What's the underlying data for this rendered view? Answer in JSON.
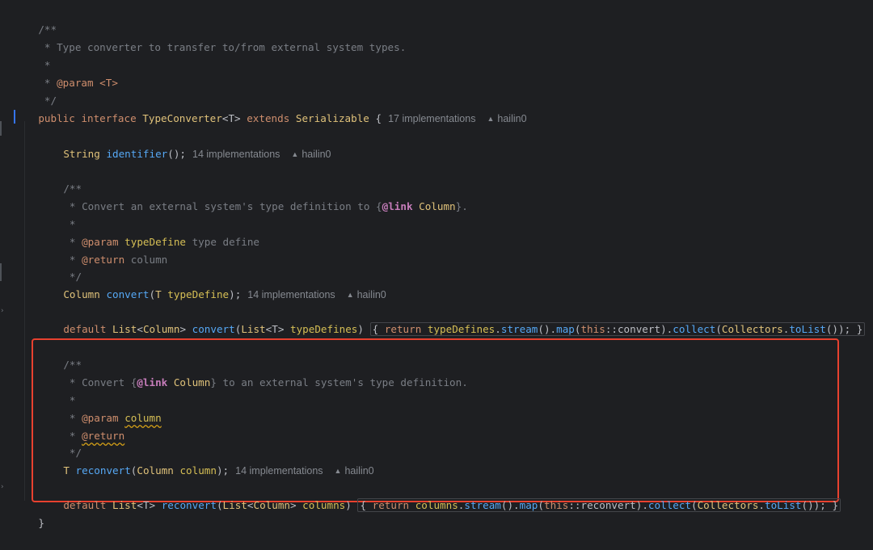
{
  "code": {
    "l1": "/**",
    "l2_star": " *",
    "l2_text": " Type converter to transfer to/from external system types.",
    "l3": " *",
    "l4_star": " * ",
    "l4_tag": "@param",
    "l4_val": " <T>",
    "l5": " */",
    "iface_public": "public",
    "iface_interface": "interface",
    "iface_name": "TypeConverter",
    "iface_generic": "<T>",
    "iface_extends": "extends",
    "iface_serializable": "Serializable",
    "iface_brace": "{",
    "iface_impl": "17 implementations",
    "iface_user": "hailin0",
    "m1_type": "String",
    "m1_name": "identifier",
    "m1_rest": "();",
    "m1_impl": "14 implementations",
    "m1_user": "hailin0",
    "d2_l1": "/**",
    "d2_l2a": " * Convert an external system's type definition to ",
    "d2_l2_open": "{",
    "d2_l2_tag": "@link",
    "d2_l2_target": " Column",
    "d2_l2_close": "}",
    "d2_l2_dot": ".",
    "d2_l3": " *",
    "d2_l4_star": " * ",
    "d2_l4_tag": "@param",
    "d2_l4_name": " typeDefine",
    "d2_l4_desc": " type define",
    "d2_l5_star": " * ",
    "d2_l5_tag": "@return",
    "d2_l5_desc": " column",
    "d2_l6": " */",
    "m2_type": "Column",
    "m2_name": "convert",
    "m2_paren": "(",
    "m2_ptype": "T",
    "m2_pname": " typeDefine",
    "m2_end": ");",
    "m2_impl": "14 implementations",
    "m2_user": "hailin0",
    "m3_default": "default",
    "m3_list": "List",
    "m3_gen_open": "<",
    "m3_gen_type": "Column",
    "m3_gen_close": ">",
    "m3_name": "convert",
    "m3_paren": "(",
    "m3_ptype": "List",
    "m3_pgen": "<T>",
    "m3_pname": " typeDefines",
    "m3_pclose": ")",
    "m3_body_open": "{",
    "m3_return": "return",
    "m3_var": " typeDefines",
    "m3_dot1": ".",
    "m3_stream": "stream",
    "m3_call1": "().",
    "m3_map": "map",
    "m3_map_open": "(",
    "m3_this": "this",
    "m3_ref": "::convert",
    "m3_map_close": ").",
    "m3_collect": "collect",
    "m3_c_open": "(",
    "m3_collectors": "Collectors",
    "m3_dot2": ".",
    "m3_tolist": "toList",
    "m3_tail": "());",
    "m3_body_close": "}",
    "d3_l1": "/**",
    "d3_l2a": " * Convert ",
    "d3_l2_open": "{",
    "d3_l2_tag": "@link",
    "d3_l2_target": " Column",
    "d3_l2_close": "}",
    "d3_l2b": " to an external system's type definition.",
    "d3_l3": " *",
    "d3_l4_star": " * ",
    "d3_l4_tag": "@param",
    "d3_l4_space": " ",
    "d3_l4_name": "column",
    "d3_l5_star": " * ",
    "d3_l5_tag": "@return",
    "d3_l6": " */",
    "m4_type": "T",
    "m4_name": "reconvert",
    "m4_paren": "(",
    "m4_ptype": "Column",
    "m4_pname": " column",
    "m4_end": ");",
    "m4_impl": "14 implementations",
    "m4_user": "hailin0",
    "m5_default": "default",
    "m5_list": "List",
    "m5_gen": "<T>",
    "m5_name": "reconvert",
    "m5_paren": "(",
    "m5_ptype": "List",
    "m5_pgen_open": "<",
    "m5_pgen_type": "Column",
    "m5_pgen_close": ">",
    "m5_pname": " columns",
    "m5_pclose": ")",
    "m5_body_open": "{",
    "m5_return": "return",
    "m5_var": " columns",
    "m5_dot1": ".",
    "m5_stream": "stream",
    "m5_call1": "().",
    "m5_map": "map",
    "m5_map_open": "(",
    "m5_this": "this",
    "m5_ref": "::reconvert",
    "m5_map_close": ").",
    "m5_collect": "collect",
    "m5_c_open": "(",
    "m5_collectors": "Collectors",
    "m5_dot2": ".",
    "m5_tolist": "toList",
    "m5_tail": "());",
    "m5_body_close": "}",
    "close_brace": "}"
  },
  "icons": {
    "user": "person-icon",
    "fold": "chevron-right-icon"
  },
  "colors": {
    "background": "#1e1f22",
    "keyword": "#cf8e6d",
    "type": "#e0c27a",
    "method": "#56a8f5",
    "comment": "#7a7e85",
    "highlight_border": "#e8412f",
    "caret": "#3574f0"
  }
}
